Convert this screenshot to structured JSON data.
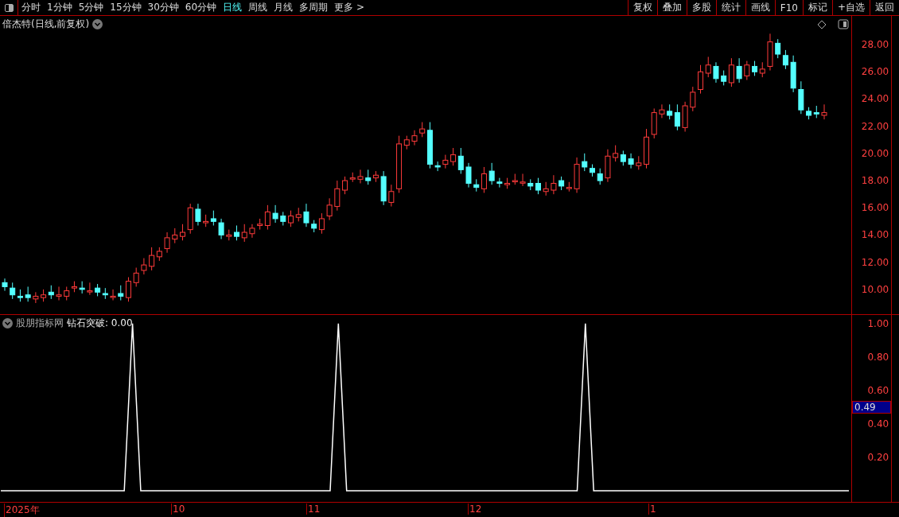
{
  "toolbar": {
    "periods": [
      {
        "label": "分时",
        "selected": false
      },
      {
        "label": "1分钟",
        "selected": false
      },
      {
        "label": "5分钟",
        "selected": false
      },
      {
        "label": "15分钟",
        "selected": false
      },
      {
        "label": "30分钟",
        "selected": false
      },
      {
        "label": "60分钟",
        "selected": false
      },
      {
        "label": "日线",
        "selected": true
      },
      {
        "label": "周线",
        "selected": false
      },
      {
        "label": "月线",
        "selected": false
      },
      {
        "label": "多周期",
        "selected": false
      },
      {
        "label": "更多 >",
        "selected": false
      }
    ],
    "actions": [
      "复权",
      "叠加",
      "多股",
      "统计",
      "画线",
      "F10",
      "标记",
      "+自选",
      "返回"
    ]
  },
  "price_panel": {
    "title": "倍杰特(日线,前复权)",
    "chart_data": {
      "type": "candlestick",
      "categories": [
        null,
        null,
        null,
        null,
        null,
        null,
        null,
        null,
        null,
        null,
        null,
        null,
        null,
        null,
        null,
        null,
        null,
        null,
        null,
        null,
        null,
        null,
        null,
        null,
        null,
        null,
        null,
        null,
        null,
        null,
        null,
        null,
        null,
        null,
        null,
        null,
        null,
        null,
        null,
        null,
        null,
        null,
        null,
        null,
        null,
        null,
        null,
        null,
        null,
        null,
        null,
        null,
        null,
        null,
        null,
        null,
        null,
        null,
        null,
        null,
        null,
        null,
        null,
        null,
        null,
        null,
        null,
        null,
        null,
        null,
        null,
        null,
        null,
        null,
        null,
        null,
        null,
        null,
        null,
        null,
        null,
        null,
        null,
        null,
        null,
        null,
        null,
        null,
        null,
        null,
        null,
        null,
        null,
        null,
        null,
        null,
        null,
        null,
        null,
        null,
        null,
        null,
        null,
        null,
        null,
        null,
        null
      ],
      "ohlc": [
        [
          10.5,
          10.8,
          9.9,
          10.2
        ],
        [
          10.1,
          10.5,
          9.3,
          9.6
        ],
        [
          9.5,
          10.0,
          9.1,
          9.4
        ],
        [
          9.6,
          10.2,
          9.1,
          9.4
        ],
        [
          9.3,
          9.8,
          9.0,
          9.5
        ],
        [
          9.4,
          10.0,
          9.1,
          9.6
        ],
        [
          9.8,
          10.3,
          9.3,
          9.6
        ],
        [
          9.5,
          10.2,
          9.2,
          9.6
        ],
        [
          9.5,
          10.2,
          9.2,
          9.9
        ],
        [
          10.1,
          10.6,
          9.8,
          10.2
        ],
        [
          10.1,
          10.6,
          9.7,
          10.0
        ],
        [
          9.9,
          10.5,
          9.6,
          9.9
        ],
        [
          10.1,
          10.4,
          9.5,
          9.8
        ],
        [
          9.7,
          10.1,
          9.3,
          9.6
        ],
        [
          9.5,
          10.0,
          9.2,
          9.5
        ],
        [
          9.7,
          10.3,
          9.2,
          9.5
        ],
        [
          9.4,
          10.9,
          9.1,
          10.6
        ],
        [
          10.5,
          11.6,
          10.2,
          11.2
        ],
        [
          11.4,
          12.3,
          11.1,
          11.8
        ],
        [
          11.7,
          13.1,
          11.4,
          12.5
        ],
        [
          12.4,
          13.1,
          12.1,
          12.8
        ],
        [
          13.0,
          14.2,
          12.7,
          13.8
        ],
        [
          13.7,
          14.5,
          13.4,
          14.0
        ],
        [
          13.9,
          14.8,
          13.6,
          14.2
        ],
        [
          14.4,
          16.3,
          14.1,
          16.0
        ],
        [
          15.9,
          16.3,
          14.7,
          15.0
        ],
        [
          14.9,
          15.5,
          14.6,
          15.0
        ],
        [
          15.2,
          15.8,
          14.7,
          15.0
        ],
        [
          14.9,
          15.2,
          13.7,
          14.0
        ],
        [
          13.9,
          14.4,
          13.6,
          14.0
        ],
        [
          14.2,
          14.7,
          13.6,
          13.9
        ],
        [
          13.8,
          14.8,
          13.5,
          14.2
        ],
        [
          14.1,
          14.8,
          13.8,
          14.5
        ],
        [
          14.7,
          15.2,
          14.4,
          14.8
        ],
        [
          14.7,
          16.2,
          14.4,
          15.7
        ],
        [
          15.6,
          16.2,
          14.9,
          15.2
        ],
        [
          15.4,
          15.7,
          14.7,
          15.0
        ],
        [
          14.9,
          15.8,
          14.6,
          15.4
        ],
        [
          15.3,
          16.0,
          15.0,
          15.5
        ],
        [
          15.7,
          16.3,
          14.6,
          14.9
        ],
        [
          14.8,
          15.1,
          14.2,
          14.5
        ],
        [
          14.4,
          15.6,
          14.1,
          15.2
        ],
        [
          15.4,
          16.7,
          15.1,
          16.2
        ],
        [
          16.1,
          18.0,
          15.8,
          17.4
        ],
        [
          17.3,
          18.3,
          17.0,
          18.0
        ],
        [
          18.2,
          18.6,
          17.9,
          18.2
        ],
        [
          18.1,
          18.8,
          17.8,
          18.3
        ],
        [
          18.2,
          18.8,
          17.7,
          18.0
        ],
        [
          18.2,
          18.7,
          17.9,
          18.4
        ],
        [
          18.3,
          18.7,
          16.2,
          16.5
        ],
        [
          16.4,
          17.7,
          16.1,
          17.2
        ],
        [
          17.4,
          21.3,
          17.1,
          20.7
        ],
        [
          20.6,
          21.3,
          20.3,
          21.0
        ],
        [
          20.9,
          21.7,
          20.6,
          21.3
        ],
        [
          21.5,
          22.3,
          21.2,
          21.8
        ],
        [
          21.7,
          22.3,
          18.9,
          19.2
        ],
        [
          19.1,
          19.4,
          18.7,
          19.0
        ],
        [
          19.2,
          19.9,
          18.9,
          19.5
        ],
        [
          19.4,
          20.4,
          19.1,
          19.9
        ],
        [
          19.8,
          20.4,
          18.5,
          18.8
        ],
        [
          19.0,
          19.3,
          17.5,
          17.8
        ],
        [
          17.7,
          18.1,
          17.2,
          17.5
        ],
        [
          17.4,
          19.0,
          17.1,
          18.5
        ],
        [
          18.7,
          19.3,
          17.7,
          18.0
        ],
        [
          17.9,
          18.2,
          17.5,
          17.8
        ],
        [
          17.7,
          18.2,
          17.4,
          17.8
        ],
        [
          18.0,
          18.5,
          17.7,
          18.0
        ],
        [
          17.9,
          18.5,
          17.6,
          17.9
        ],
        [
          17.8,
          18.1,
          17.3,
          17.6
        ],
        [
          17.8,
          18.2,
          17.0,
          17.3
        ],
        [
          17.2,
          17.9,
          16.9,
          17.4
        ],
        [
          17.3,
          18.4,
          17.0,
          17.8
        ],
        [
          18.0,
          18.3,
          17.3,
          17.6
        ],
        [
          17.5,
          17.9,
          17.2,
          17.5
        ],
        [
          17.4,
          19.7,
          17.1,
          19.2
        ],
        [
          19.4,
          20.0,
          18.7,
          19.0
        ],
        [
          18.9,
          19.2,
          18.3,
          18.6
        ],
        [
          18.5,
          18.9,
          17.7,
          18.0
        ],
        [
          18.2,
          20.3,
          17.9,
          19.8
        ],
        [
          19.7,
          20.6,
          19.4,
          20.0
        ],
        [
          19.9,
          20.2,
          19.1,
          19.4
        ],
        [
          19.6,
          20.0,
          18.9,
          19.2
        ],
        [
          19.1,
          19.8,
          18.8,
          19.3
        ],
        [
          19.2,
          21.8,
          18.9,
          21.2
        ],
        [
          21.4,
          23.3,
          21.1,
          23.0
        ],
        [
          22.9,
          23.6,
          22.6,
          23.2
        ],
        [
          23.1,
          23.6,
          22.5,
          22.8
        ],
        [
          23.0,
          23.6,
          21.7,
          22.0
        ],
        [
          21.9,
          23.8,
          21.6,
          23.5
        ],
        [
          23.4,
          24.9,
          23.1,
          24.5
        ],
        [
          24.7,
          26.5,
          24.4,
          26.0
        ],
        [
          25.9,
          27.1,
          25.6,
          26.5
        ],
        [
          26.4,
          26.7,
          25.2,
          25.5
        ],
        [
          25.7,
          26.1,
          25.0,
          25.3
        ],
        [
          25.2,
          27.0,
          24.9,
          26.5
        ],
        [
          26.4,
          27.0,
          25.2,
          25.5
        ],
        [
          25.7,
          26.8,
          25.4,
          26.5
        ],
        [
          26.4,
          26.8,
          25.7,
          26.0
        ],
        [
          25.9,
          26.7,
          25.6,
          26.2
        ],
        [
          26.4,
          28.8,
          26.1,
          28.2
        ],
        [
          28.1,
          28.4,
          27.0,
          27.3
        ],
        [
          27.2,
          27.6,
          26.2,
          26.5
        ],
        [
          26.7,
          27.2,
          24.5,
          24.8
        ],
        [
          24.7,
          25.3,
          22.9,
          23.2
        ],
        [
          23.1,
          23.4,
          22.5,
          22.8
        ],
        [
          23.0,
          23.5,
          22.6,
          22.9
        ],
        [
          22.8,
          23.6,
          22.5,
          23.0
        ]
      ],
      "ylim": [
        8.18,
        30.11
      ],
      "yticks": [
        {
          "value": 28,
          "label": "28.00"
        },
        {
          "value": 26,
          "label": "26.00"
        },
        {
          "value": 24,
          "label": "24.00"
        },
        {
          "value": 22,
          "label": "22.00"
        },
        {
          "value": 20,
          "label": "20.00"
        },
        {
          "value": 18,
          "label": "18.00"
        },
        {
          "value": 16,
          "label": "16.00"
        },
        {
          "value": 14,
          "label": "14.00"
        },
        {
          "value": 12,
          "label": "12.00"
        },
        {
          "value": 10,
          "label": "10.00"
        }
      ]
    }
  },
  "indicator_panel": {
    "source": "股朋指标网",
    "reading": ": 0.00",
    "cursor_value": "0.49",
    "chart_data": {
      "type": "line",
      "categories": [
        null,
        null,
        null,
        null,
        null,
        null,
        null,
        null,
        null,
        null,
        null,
        null,
        null,
        null,
        null,
        null,
        null,
        null,
        null,
        null,
        null,
        null,
        null,
        null,
        null,
        null,
        null,
        null,
        null,
        null,
        null,
        null,
        null,
        null,
        null,
        null,
        null,
        null,
        null,
        null,
        null,
        null,
        null,
        null,
        null,
        null,
        null,
        null,
        null,
        null,
        null,
        null,
        null,
        null,
        null,
        null,
        null,
        null,
        null,
        null,
        null,
        null,
        null,
        null,
        null,
        null,
        null,
        null,
        null,
        null,
        null,
        null,
        null,
        null,
        null,
        null,
        null,
        null,
        null,
        null,
        null,
        null,
        null,
        null,
        null,
        null,
        null,
        null,
        null,
        null,
        null,
        null,
        null,
        null,
        null,
        null,
        null,
        null,
        null,
        null,
        null,
        null,
        null,
        null
      ],
      "series": [
        {
          "name": "钻石突破",
          "color": "#ffffff",
          "values": [
            0,
            0,
            0,
            0,
            0,
            0,
            0,
            0,
            0,
            0,
            0,
            0,
            0,
            0,
            0,
            0,
            1,
            0,
            0,
            0,
            0,
            0,
            0,
            0,
            0,
            0,
            0,
            0,
            0,
            0,
            0,
            0,
            0,
            0,
            0,
            0,
            0,
            0,
            0,
            0,
            0,
            1,
            0,
            0,
            0,
            0,
            0,
            0,
            0,
            0,
            0,
            0,
            0,
            0,
            0,
            0,
            0,
            0,
            0,
            0,
            0,
            0,
            0,
            0,
            0,
            0,
            0,
            0,
            0,
            0,
            0,
            1,
            0,
            0,
            0,
            0,
            0,
            0,
            0,
            0,
            0,
            0,
            0,
            0,
            0,
            0,
            0,
            0,
            0,
            0,
            0,
            0,
            0,
            0,
            0,
            0,
            0,
            0,
            0,
            0,
            0,
            0,
            0,
            0
          ]
        }
      ],
      "ylim": [
        -0.067,
        1.052
      ],
      "yticks": [
        {
          "value": 1,
          "label": "1.00"
        },
        {
          "value": 0.8,
          "label": "0.80"
        },
        {
          "value": 0.6,
          "label": "0.60"
        },
        {
          "value": 0.4,
          "label": "0.40"
        },
        {
          "value": 0.2,
          "label": "0.20"
        }
      ]
    }
  },
  "time_axis": [
    "2025年",
    "10",
    "11",
    "12",
    "1"
  ]
}
